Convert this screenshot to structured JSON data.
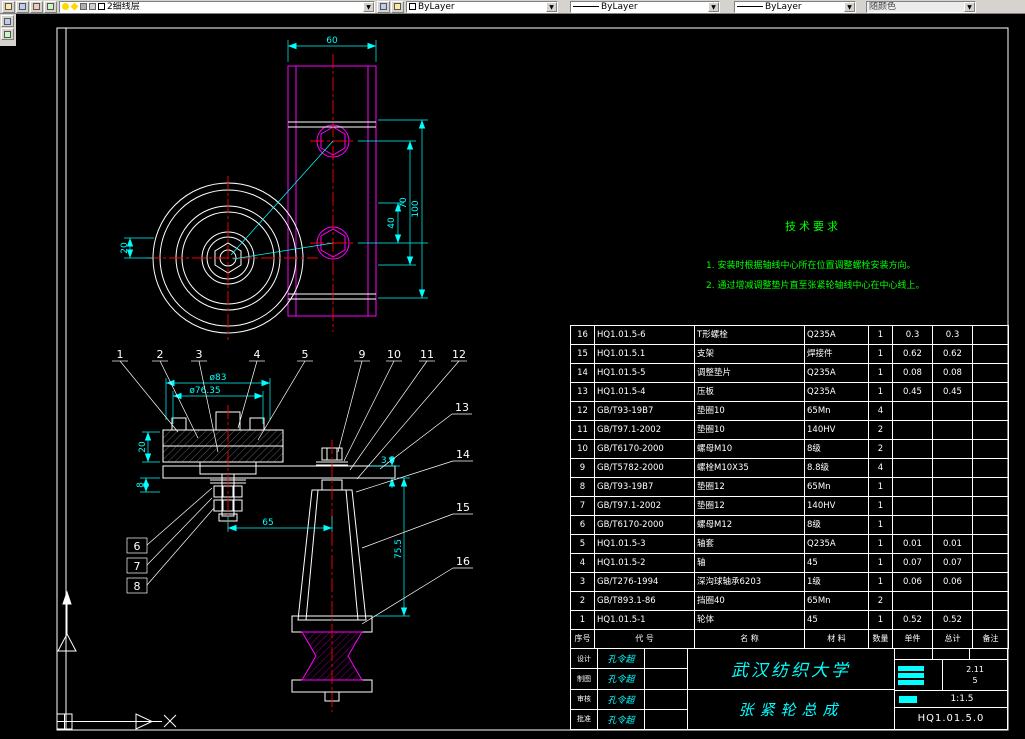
{
  "toolbar": {
    "layer": "2细线层",
    "color": "ByLayer",
    "linetype": "ByLayer",
    "lineweight": "ByLayer",
    "plot_style": "随颜色"
  },
  "drawing": {
    "tech_req": {
      "title": "技术要求",
      "line1": "1. 安装时根据轴线中心所在位置调整螺栓安装方向。",
      "line2": "2. 通过增减调整垫片直至张紧轮轴线中心在中心线上。"
    },
    "dims": {
      "w60": "60",
      "h40": "40",
      "h70": "70",
      "h100": "100",
      "h20_top": "20",
      "dia83": "ø83",
      "dia7635": "ø76.35",
      "h20_front": "20",
      "h8": "8",
      "w65": "65",
      "t35": "3.5",
      "h755": "75.5"
    },
    "balloons": [
      "1",
      "2",
      "3",
      "4",
      "5",
      "9",
      "10",
      "11",
      "12",
      "13",
      "14",
      "15",
      "16",
      "6",
      "7",
      "8"
    ]
  },
  "bom": {
    "headers": [
      "序号",
      "代 号",
      "名 称",
      "材 料",
      "数量",
      "单件",
      "总计",
      "备注"
    ],
    "rows": [
      {
        "no": "16",
        "code": "HQ1.01.5-6",
        "name": "T形螺栓",
        "material": "Q235A",
        "qty": "1",
        "unit": "0.3",
        "total": "0.3",
        "note": ""
      },
      {
        "no": "15",
        "code": "HQ1.01.5.1",
        "name": "支架",
        "material": "焊接件",
        "qty": "1",
        "unit": "0.62",
        "total": "0.62",
        "note": ""
      },
      {
        "no": "14",
        "code": "HQ1.01.5-5",
        "name": "调整垫片",
        "material": "Q235A",
        "qty": "1",
        "unit": "0.08",
        "total": "0.08",
        "note": ""
      },
      {
        "no": "13",
        "code": "HQ1.01.5-4",
        "name": "压板",
        "material": "Q235A",
        "qty": "1",
        "unit": "0.45",
        "total": "0.45",
        "note": ""
      },
      {
        "no": "12",
        "code": "GB/T93-19B7",
        "name": "垫圈10",
        "material": "65Mn",
        "qty": "4",
        "unit": "",
        "total": "",
        "note": ""
      },
      {
        "no": "11",
        "code": "GB/T97.1-2002",
        "name": "垫圈10",
        "material": "140HV",
        "qty": "2",
        "unit": "",
        "total": "",
        "note": ""
      },
      {
        "no": "10",
        "code": "GB/T6170-2000",
        "name": "螺母M10",
        "material": "8级",
        "qty": "2",
        "unit": "",
        "total": "",
        "note": ""
      },
      {
        "no": "9",
        "code": "GB/T5782-2000",
        "name": "螺栓M10X35",
        "material": "8.8级",
        "qty": "4",
        "unit": "",
        "total": "",
        "note": ""
      },
      {
        "no": "8",
        "code": "GB/T93-19B7",
        "name": "垫圈12",
        "material": "65Mn",
        "qty": "1",
        "unit": "",
        "total": "",
        "note": ""
      },
      {
        "no": "7",
        "code": "GB/T97.1-2002",
        "name": "垫圈12",
        "material": "140HV",
        "qty": "1",
        "unit": "",
        "total": "",
        "note": ""
      },
      {
        "no": "6",
        "code": "GB/T6170-2000",
        "name": "螺母M12",
        "material": "8级",
        "qty": "1",
        "unit": "",
        "total": "",
        "note": ""
      },
      {
        "no": "5",
        "code": "HQ1.01.5-3",
        "name": "轴套",
        "material": "Q235A",
        "qty": "1",
        "unit": "0.01",
        "total": "0.01",
        "note": ""
      },
      {
        "no": "4",
        "code": "HQ1.01.5-2",
        "name": "轴",
        "material": "45",
        "qty": "1",
        "unit": "0.07",
        "total": "0.07",
        "note": ""
      },
      {
        "no": "3",
        "code": "GB/T276-1994",
        "name": "深沟球轴承6203",
        "material": "1级",
        "qty": "1",
        "unit": "0.06",
        "total": "0.06",
        "note": ""
      },
      {
        "no": "2",
        "code": "GB/T893.1-86",
        "name": "挡圈40",
        "material": "65Mn",
        "qty": "2",
        "unit": "",
        "total": "",
        "note": ""
      },
      {
        "no": "1",
        "code": "HQ1.01.5-1",
        "name": "轮体",
        "material": "45",
        "qty": "1",
        "unit": "0.52",
        "total": "0.52",
        "note": ""
      }
    ]
  },
  "titleblock": {
    "school": "武汉纺织大学",
    "title": "张紧轮总成",
    "drawing_no": "HQ1.01.5.0",
    "scale": "1:1.5",
    "weight": "2.11",
    "sheet": "5",
    "signatures": [
      {
        "label": "设计",
        "name": "孔令超"
      },
      {
        "label": "制图",
        "name": "孔令超"
      },
      {
        "label": "审核",
        "name": "孔令超"
      },
      {
        "label": "批准",
        "name": "孔令超"
      }
    ]
  }
}
